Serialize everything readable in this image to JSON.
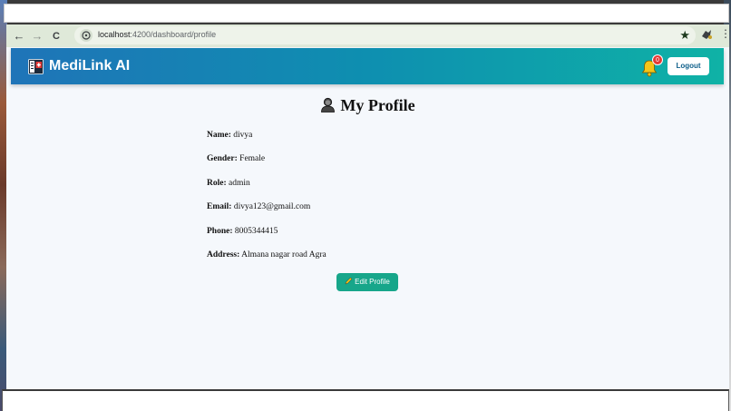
{
  "browser": {
    "url_host": "localhost",
    "url_rest": ":4200/dashboard/profile",
    "back_icon": "←",
    "forward_icon": "→",
    "reload_icon": "C",
    "star_icon": "★",
    "menu_icon": "⋮"
  },
  "header": {
    "brand": "MediLink AI",
    "notification_count": "0",
    "logout_label": "Logout",
    "gradient_start": "#1f74b8",
    "gradient_end": "#0fb2a6"
  },
  "profile": {
    "title": "My Profile",
    "fields": [
      {
        "label": "Name:",
        "value": "divya"
      },
      {
        "label": "Gender:",
        "value": "Female"
      },
      {
        "label": "Role:",
        "value": "admin"
      },
      {
        "label": "Email:",
        "value": "divya123@gmail.com"
      },
      {
        "label": "Phone:",
        "value": "8005344415"
      },
      {
        "label": "Address:",
        "value": "Almana nagar road Agra"
      }
    ],
    "edit_label": "Edit Profile",
    "edit_color": "#17a68a"
  }
}
